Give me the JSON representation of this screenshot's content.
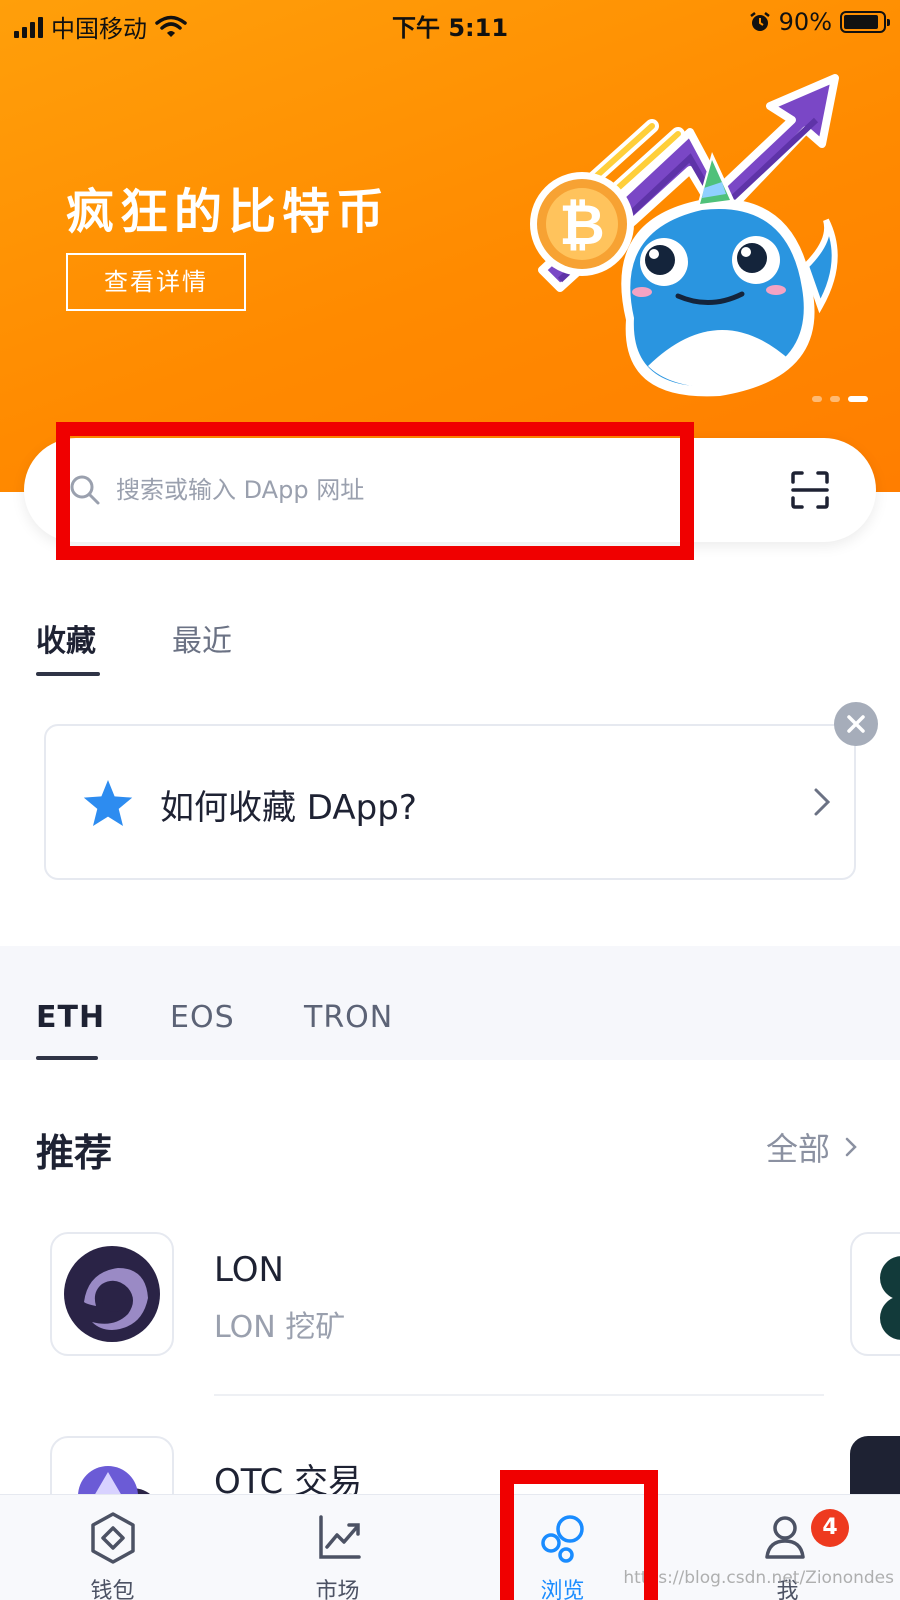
{
  "status_bar": {
    "carrier": "中国移动",
    "time": "下午 5:11",
    "battery": "90%",
    "battery_level": 0.9
  },
  "banner": {
    "title": "疯狂的比特币",
    "button_label": "查看详情",
    "carousel_total": 3,
    "carousel_active": 3
  },
  "search": {
    "placeholder": "搜索或输入 DApp 网址",
    "value": ""
  },
  "favorites_tabs": [
    {
      "label": "收藏",
      "active": true
    },
    {
      "label": "最近",
      "active": false
    }
  ],
  "tip_card": {
    "text": "如何收藏 DApp?"
  },
  "chain_tabs": [
    {
      "label": "ETH",
      "active": true
    },
    {
      "label": "EOS",
      "active": false
    },
    {
      "label": "TRON",
      "active": false
    }
  ],
  "recommended": {
    "title": "推荐",
    "see_all": "全部",
    "items": [
      {
        "name": "LON",
        "subtitle": "LON 挖矿",
        "icon": "lon-logo-icon"
      },
      {
        "name": "OTC 交易",
        "subtitle": "",
        "icon": "ethereum-icon"
      }
    ]
  },
  "bottom_nav": [
    {
      "label": "钱包",
      "icon": "wallet-icon",
      "active": false
    },
    {
      "label": "市场",
      "icon": "market-chart-icon",
      "active": false
    },
    {
      "label": "浏览",
      "icon": "browse-bubbles-icon",
      "active": true
    },
    {
      "label": "我",
      "icon": "profile-icon",
      "active": false,
      "badge": "4"
    }
  ],
  "watermark": "https://blog.csdn.net/Zionondes",
  "colors": {
    "banner_orange": "#ff8a00",
    "accent_blue": "#1a8cff",
    "highlight_red": "#f00000",
    "badge_red": "#ee3a1f"
  }
}
